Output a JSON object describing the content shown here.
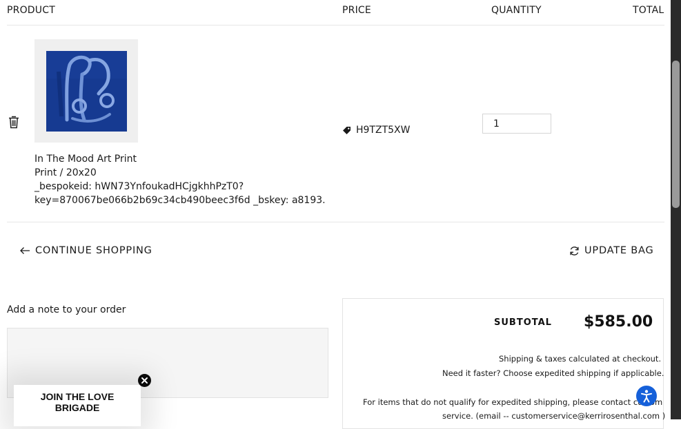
{
  "table_header": {
    "product": "PRODUCT",
    "price": "PRICE",
    "quantity": "QUANTITY",
    "total": "TOTAL"
  },
  "cart_item": {
    "title": "In The Mood Art Print",
    "variant": "Print / 20x20",
    "bespoke_line": "_bespokeid: hWN73YnfoukadHCjgkhhPzT0?",
    "key_line": "key=870067be066b2b69c34cb490beec3f6d _bskey: a8193.",
    "price_code": "H9TZT5XW",
    "quantity": "1",
    "icons": {
      "remove": "trash-icon",
      "price": "price-tag-icon"
    }
  },
  "actions": {
    "continue_shopping": "CONTINUE SHOPPING",
    "update_bag": "UPDATE BAG",
    "icons": {
      "continue": "arrow-left-icon",
      "update": "refresh-icon"
    }
  },
  "note": {
    "label": "Add a note to your order",
    "value": ""
  },
  "summary": {
    "subtotal_label": "SUBTOTAL",
    "subtotal_value": "$585.00",
    "shipping_note": "Shipping & taxes calculated at checkout.",
    "expedite_note": "Need it faster? Choose expedited shipping if applicable.",
    "contact_line1": "For items that do not qualify for expedited shipping, please contact custom",
    "contact_line2": "service. (email -- customerservice@kerrirosenthal.com )"
  },
  "popup": {
    "text": "JOIN THE LOVE\nBRIGADE",
    "close_icon": "close-icon"
  },
  "accessibility": {
    "icon": "accessibility-icon",
    "color": "#1560d9"
  },
  "colors": {
    "artwork": "#163a91",
    "background": "#ffffff",
    "text": "#1a1a1a"
  }
}
